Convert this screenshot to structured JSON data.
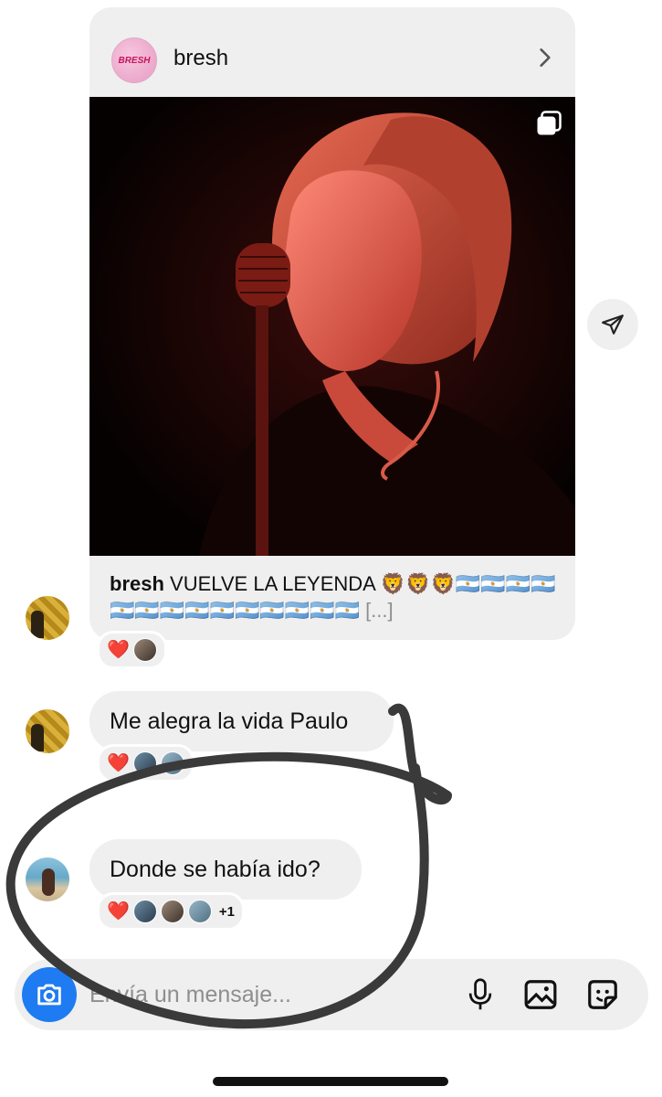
{
  "post": {
    "username": "bresh",
    "avatar_text": "BRESH",
    "caption_user": "bresh",
    "caption_text": "VUELVE LA LEYENDA 🦁🦁🦁🇦🇷🇦🇷🇦🇷🇦🇷🇦🇷🇦🇷🇦🇷🇦🇷🇦🇷🇦🇷🇦🇷🇦🇷🇦🇷🇦🇷",
    "caption_more": "[...]",
    "reactions": {
      "heart": "❤️"
    }
  },
  "messages": [
    {
      "text": "Me alegra la vida Paulo",
      "reaction_heart": "❤️"
    },
    {
      "text": "Donde se había ido?",
      "reaction_heart": "❤️",
      "reaction_count": "+1"
    }
  ],
  "composer": {
    "placeholder": "Envía un mensaje..."
  },
  "colors": {
    "accent": "#1e7bf2",
    "bubble": "#efefef",
    "heart": "#e8212e",
    "scribble": "#3a3a3a"
  }
}
